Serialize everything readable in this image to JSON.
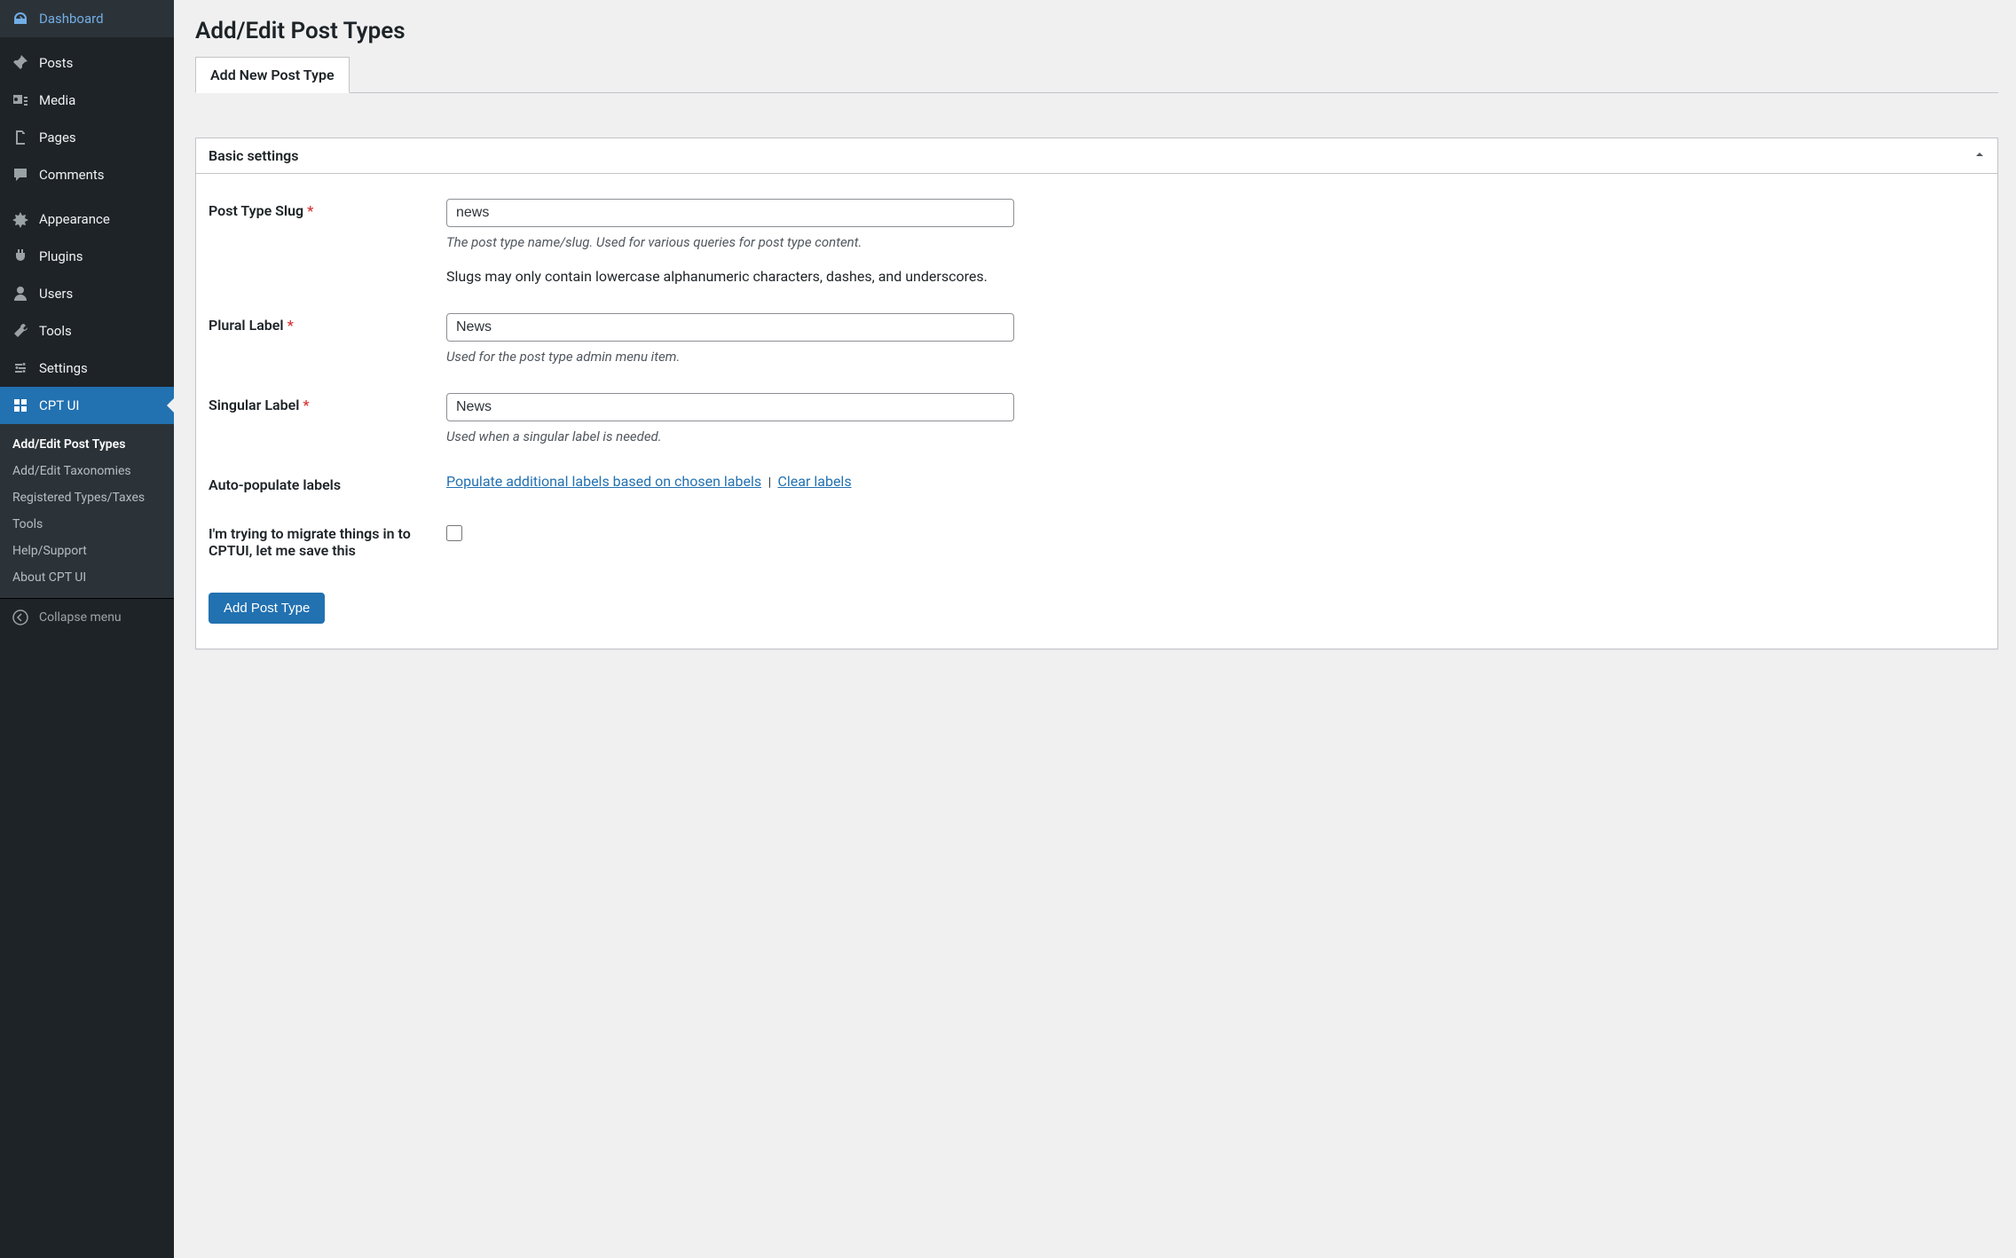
{
  "sidebar": {
    "items": [
      {
        "label": "Dashboard",
        "icon": "dashboard"
      },
      {
        "label": "Posts",
        "icon": "pin"
      },
      {
        "label": "Media",
        "icon": "media"
      },
      {
        "label": "Pages",
        "icon": "pages"
      },
      {
        "label": "Comments",
        "icon": "comment"
      },
      {
        "label": "Appearance",
        "icon": "appearance"
      },
      {
        "label": "Plugins",
        "icon": "plugin"
      },
      {
        "label": "Users",
        "icon": "user"
      },
      {
        "label": "Tools",
        "icon": "tools"
      },
      {
        "label": "Settings",
        "icon": "settings"
      },
      {
        "label": "CPT UI",
        "icon": "cptui",
        "active": true
      }
    ],
    "submenu": [
      "Add/Edit Post Types",
      "Add/Edit Taxonomies",
      "Registered Types/Taxes",
      "Tools",
      "Help/Support",
      "About CPT UI"
    ],
    "collapse_label": "Collapse menu"
  },
  "page": {
    "title": "Add/Edit Post Types",
    "tab_label": "Add New Post Type"
  },
  "panel": {
    "title": "Basic settings",
    "fields": {
      "slug": {
        "label": "Post Type Slug",
        "required": "*",
        "value": "news",
        "desc": "The post type name/slug. Used for various queries for post type content.",
        "note": "Slugs may only contain lowercase alphanumeric characters, dashes, and underscores."
      },
      "plural": {
        "label": "Plural Label",
        "required": "*",
        "value": "News",
        "desc": "Used for the post type admin menu item."
      },
      "singular": {
        "label": "Singular Label",
        "required": "*",
        "value": "News",
        "desc": "Used when a singular label is needed."
      },
      "autopop": {
        "label": "Auto-populate labels",
        "populate_link": "Populate additional labels based on chosen labels",
        "separator": "|",
        "clear_link": "Clear labels"
      },
      "migrate": {
        "label": "I'm trying to migrate things in to CPTUI, let me save this"
      }
    },
    "submit_label": "Add Post Type"
  }
}
